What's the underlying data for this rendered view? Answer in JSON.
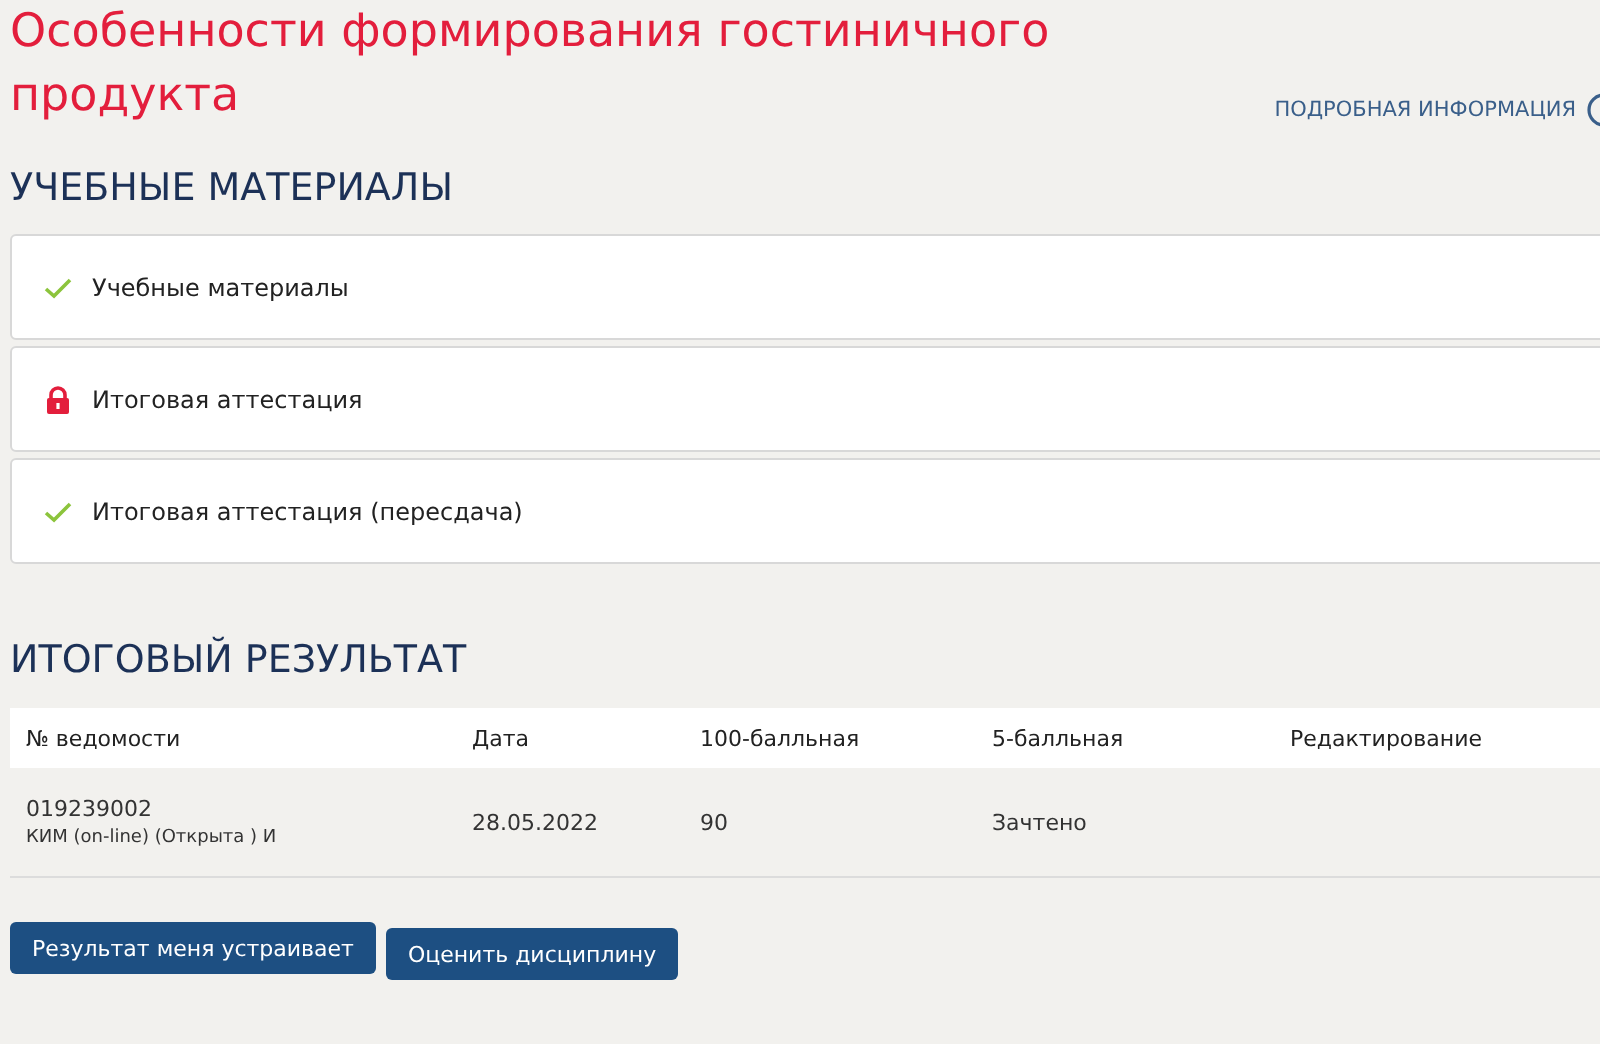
{
  "title": "Особенности формирования гостиничного продукта",
  "info_link": "ПОДРОБНАЯ ИНФОРМАЦИЯ",
  "materials": {
    "heading": "УЧЕБНЫЕ МАТЕРИАЛЫ",
    "items": [
      {
        "label": "Учебные материалы",
        "kind": "done"
      },
      {
        "label": "Итоговая аттестация",
        "kind": "locked"
      },
      {
        "label": "Итоговая аттестация (пересдача)",
        "kind": "done"
      }
    ]
  },
  "result": {
    "heading": "ИТОГОВЫЙ РЕЗУЛЬТАТ",
    "table": {
      "columns": [
        "№ ведомости",
        "Дата",
        "100-балльная",
        "5-балльная",
        "Редактирование"
      ],
      "rows": [
        {
          "number": "019239002",
          "note": "КИМ (on-line) (Открыта ) И",
          "date": "28.05.2022",
          "score100": "90",
          "score5": "Зачтено"
        }
      ]
    }
  },
  "buttons": [
    "Результат меня устраивает",
    "Оценить дисциплину"
  ]
}
